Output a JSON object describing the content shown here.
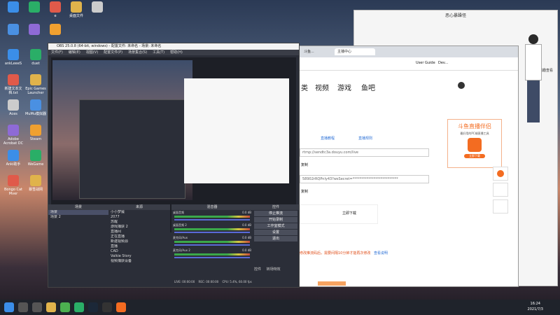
{
  "desktop": {
    "icons": [
      {
        "label": ""
      },
      {
        "label": ""
      },
      {
        "label": "e"
      },
      {
        "label": "桌面文件"
      },
      {
        "label": ""
      },
      {
        "label": ""
      },
      {
        "label": ""
      },
      {
        "label": ""
      },
      {
        "label": "ankLeeeS"
      },
      {
        "label": "duet"
      },
      {
        "label": "新建文本文档.txt"
      },
      {
        "label": "Epic Games Launcher"
      },
      {
        "label": "Aces"
      },
      {
        "label": "MuMu模拟器"
      },
      {
        "label": "Adobe Acrobat DC"
      },
      {
        "label": "Steam"
      },
      {
        "label": "Anki助手"
      },
      {
        "label": "WeGame"
      },
      {
        "label": "Bongo Cat Mver"
      },
      {
        "label": "暴雪战网"
      }
    ]
  },
  "obs": {
    "title": "OBS 25.0.8 (64-bit, windows) - 配置文件: 未命名 - 场景: 未命名",
    "menu": [
      "文件(F)",
      "编辑(E)",
      "视图(V)",
      "配置文件(P)",
      "场景集合(S)",
      "工具(T)",
      "帮助(H)"
    ],
    "panels": {
      "scenes": "场景",
      "sources": "来源",
      "mixer": "混音器",
      "transitions": "转场",
      "controls": "控件"
    },
    "scene_list": [
      "场景",
      "场景 2"
    ],
    "source_list": [
      "小小梦魇",
      "2077",
      "苏醒",
      "游戏捕获 2",
      "直播间",
      "正在直播",
      "新建视频源",
      "直播",
      "CAD",
      "Valkie Story",
      "视频捕获设备"
    ],
    "mixer": [
      {
        "name": "桌面音频",
        "level": "0.0 dB"
      },
      {
        "name": "桌面音频 2",
        "level": "0.0 dB"
      },
      {
        "name": "麦克风/Aux",
        "level": "0.0 dB"
      },
      {
        "name": "麦克风/Aux 2",
        "level": "0.0 dB"
      }
    ],
    "controls": [
      "停止推流",
      "开始录制",
      "工作室模式",
      "设置",
      "退出"
    ],
    "status": {
      "live": "LIVE: 00:00:00",
      "rec": "REC: 00:00:00",
      "cpu": "CPU: 5.4%, 60.00 fps"
    },
    "bottom_tabs": [
      "控件",
      "转场特效"
    ]
  },
  "browser": {
    "tabs": [
      "斗鱼...",
      "主播中心"
    ],
    "bookmarks": [
      "User Guide",
      "Dev..."
    ],
    "nav": [
      "类",
      "视频",
      "游戏",
      "鱼吧"
    ],
    "links": {
      "tutorial": "直播教程",
      "rules": "直播规则"
    },
    "server_url": "rtmp://sendtc3a.douyu.com/live",
    "stream_key": "58902rRQPnly43?wsSecret=**************************",
    "copy1": "复制",
    "copy2": "复制",
    "download_btn": "立即下载",
    "notice": "修改推流码后，需要间隔10分钟才能再次修改",
    "notice_link": "查看说明",
    "promo_title": "斗鱼直播伴侣",
    "promo_sub": "最好用的PC端直播工具",
    "promo_btn": "立即下载"
  },
  "chat": {
    "title": "恶心暴躁怪",
    "label": "闲趣查看"
  },
  "taskbar": {
    "time": "16:24",
    "date": "2021/7/3"
  }
}
